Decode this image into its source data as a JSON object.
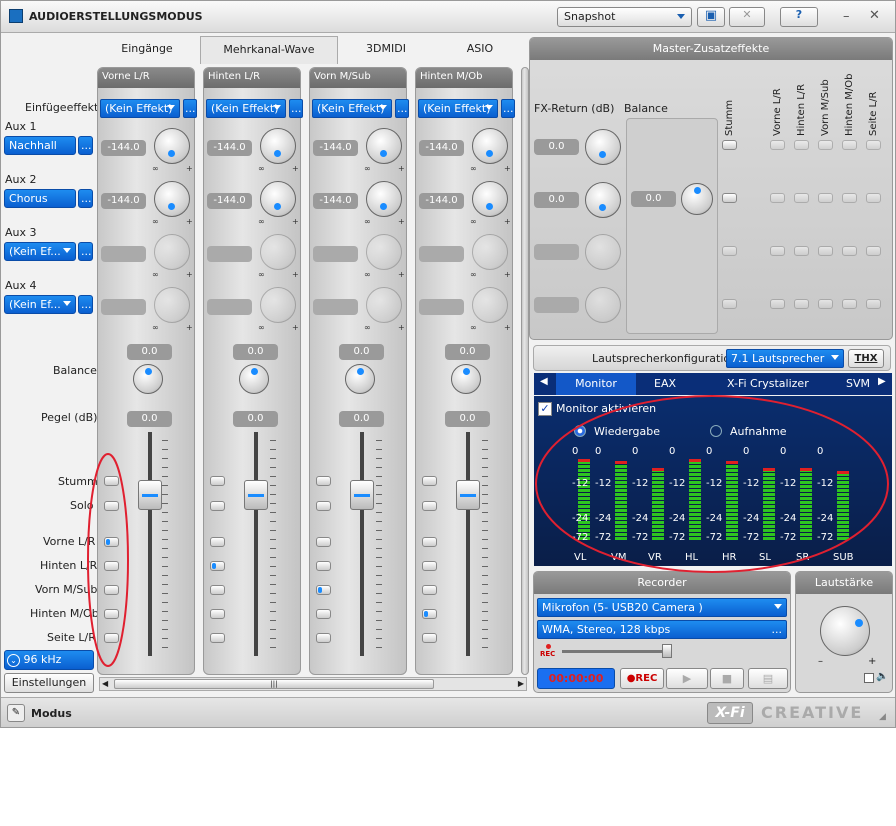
{
  "window": {
    "title": "AUDIOERSTELLUNGSMODUS",
    "snapshot": "Snapshot",
    "help": "?"
  },
  "tabs": [
    "Eingänge",
    "Mehrkanal-Wave",
    "3DMIDI",
    "ASIO"
  ],
  "labels": {
    "einfuege": "Einfügeeffekt",
    "aux1": "Aux 1",
    "aux2": "Aux 2",
    "aux3": "Aux 3",
    "aux4": "Aux 4",
    "balance": "Balance",
    "pegel": "Pegel (dB)",
    "stumm": "Stumm",
    "solo": "Solo",
    "vl": "Vorne L/R",
    "hl": "Hinten L/R",
    "vm": "Vorn M/Sub",
    "hm": "Hinten M/Ob",
    "sl": "Seite L/R"
  },
  "left": {
    "aux1": "Nachhall",
    "aux2": "Chorus",
    "aux3": "(Kein Ef...",
    "aux4": "(Kein Ef...",
    "rate": "96 kHz",
    "settings": "Einstellungen",
    "more": "..."
  },
  "channels": [
    {
      "name": "Vorne L/R",
      "fx": "(Kein Effekt)",
      "aux1": "-144.0",
      "aux2": "-144.0",
      "bal": "0.0",
      "pegel": "0.0"
    },
    {
      "name": "Hinten L/R",
      "fx": "(Kein Effekt)",
      "aux1": "-144.0",
      "aux2": "-144.0",
      "bal": "0.0",
      "pegel": "0.0"
    },
    {
      "name": "Vorn M/Sub",
      "fx": "(Kein Effekt)",
      "aux1": "-144.0",
      "aux2": "-144.0",
      "bal": "0.0",
      "pegel": "0.0"
    },
    {
      "name": "Hinten M/Ob",
      "fx": "(Kein Effekt)",
      "aux1": "-144.0",
      "aux2": "-144.0",
      "bal": "0.0",
      "pegel": "0.0"
    }
  ],
  "master": {
    "title": "Master-Zusatzeffekte",
    "fxret": "FX-Return (dB)",
    "balance": "Balance",
    "v1": "0.0",
    "v2": "0.0",
    "bal": "0.0",
    "cols": [
      "Stumm",
      "Vorne L/R",
      "Hinten L/R",
      "Vorn M/Sub",
      "Hinten M/Ob",
      "Seite L/R"
    ]
  },
  "speaker": {
    "label": "Lautsprecherkonfiguration:",
    "value": "7.1 Lautsprecher",
    "thx": "THX"
  },
  "monitor": {
    "tabs": [
      "Monitor",
      "EAX",
      "X-Fi Crystalizer",
      "SVM"
    ],
    "enable": "Monitor aktivieren",
    "playback": "Wiedergabe",
    "record": "Aufnahme",
    "scale": [
      "0",
      "-12",
      "-24",
      "-72"
    ],
    "channels": [
      "VL",
      "VM",
      "VR",
      "HL",
      "HR",
      "SL",
      "SR",
      "SUB"
    ],
    "levels": [
      0.92,
      0.9,
      0.82,
      0.92,
      0.9,
      0.82,
      0.82,
      0.78
    ]
  },
  "recorder": {
    "title": "Recorder",
    "source": "Mikrofon (5- USB20 Camera    )",
    "format": "WMA, Stereo, 128 kbps",
    "time": "00:00:00",
    "rec": "REC",
    "recsmall": "REC"
  },
  "volume": {
    "title": "Lautstärke"
  },
  "bottom": {
    "modus": "Modus",
    "brand": "CREATIVE",
    "xfi": "X-Fi"
  }
}
